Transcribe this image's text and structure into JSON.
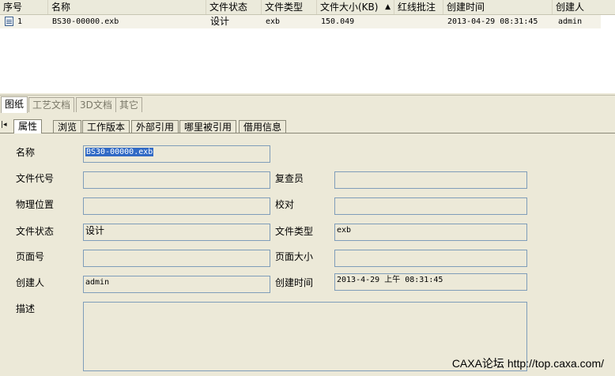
{
  "grid": {
    "columns": [
      "序号",
      "名称",
      "文件状态",
      "文件类型",
      "文件大小(KB)",
      "红线批注",
      "创建时间",
      "创建人"
    ],
    "sort_indicator": "▲",
    "row": {
      "index": "1",
      "name": "BS30-00000.exb",
      "status": "设计",
      "type": "exb",
      "size": "150.049",
      "annotation": "",
      "created": "2013-04-29 08:31:45",
      "creator": "admin"
    }
  },
  "upper_tabs": [
    "图纸",
    "工艺文档",
    "3D文档",
    "其它"
  ],
  "lower_tabs": [
    "属性",
    "浏览",
    "工作版本",
    "外部引用",
    "哪里被引用",
    "借用信息"
  ],
  "lower_nav_glyph": "|◂",
  "form": {
    "name_label": "名称",
    "name_value": "BS30-00000.exb",
    "code_label": "文件代号",
    "code_value": "",
    "reviewer_label": "复查员",
    "reviewer_value": "",
    "location_label": "物理位置",
    "location_value": "",
    "proof_label": "校对",
    "proof_value": "",
    "status_label": "文件状态",
    "status_value": "设计",
    "type_label": "文件类型",
    "type_value": "exb",
    "pages_label": "页面号",
    "pages_value": "",
    "pagesize_label": "页面大小",
    "pagesize_value": "",
    "creator_label": "创建人",
    "creator_value": "admin",
    "created_label": "创建时间",
    "created_value": "2013-4-29 上午 08:31:45",
    "desc_label": "描述",
    "desc_value": ""
  },
  "watermark": "CAXA论坛  http://top.caxa.com/",
  "colors": {
    "background": "#ece9d8",
    "field_border": "#7f9db9",
    "selection": "#316ac5"
  }
}
